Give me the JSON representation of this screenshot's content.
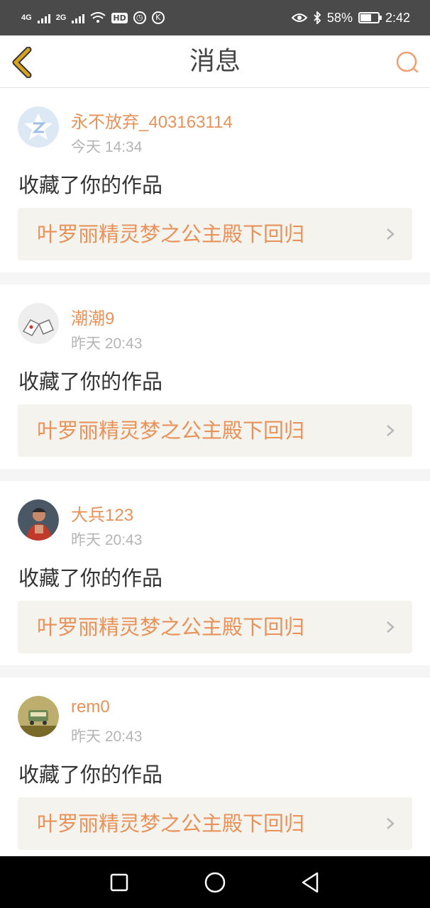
{
  "status_bar": {
    "network_1": "4G",
    "network_2": "2G",
    "hd": "HD",
    "battery": "58%",
    "time": "2:42"
  },
  "header": {
    "title": "消息",
    "back_icon": "chevron-left-icon",
    "search_icon": "search-icon"
  },
  "colors": {
    "accent": "#e8925a",
    "back_icon": "#d6a21f",
    "card_link_bg": "#f4f3ee"
  },
  "messages": [
    {
      "username": "永不放弃_403163114",
      "time": "今天 14:34",
      "action": "收藏了你的作品",
      "work_title": "叶罗丽精灵梦之公主殿下回归"
    },
    {
      "username": "潮潮9",
      "time": "昨天 20:43",
      "action": "收藏了你的作品",
      "work_title": "叶罗丽精灵梦之公主殿下回归"
    },
    {
      "username": "大兵123",
      "time": "昨天 20:43",
      "action": "收藏了你的作品",
      "work_title": "叶罗丽精灵梦之公主殿下回归"
    },
    {
      "username": "rem0",
      "time": "昨天 20:43",
      "action": "收藏了你的作品",
      "work_title": "叶罗丽精灵梦之公主殿下回归"
    }
  ],
  "nav_bar": {
    "recents_icon": "square-icon",
    "home_icon": "circle-icon",
    "back_icon": "triangle-back-icon"
  }
}
